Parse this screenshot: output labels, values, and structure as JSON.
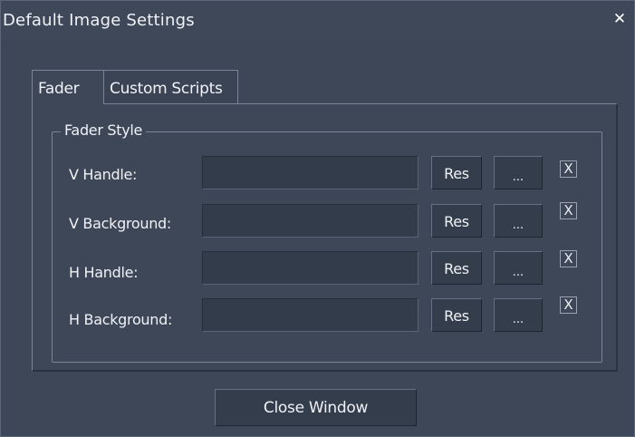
{
  "window": {
    "title": "Default Image Settings",
    "close_icon": "close-icon"
  },
  "tabs": [
    {
      "label": "Fader",
      "active": true
    },
    {
      "label": "Custom Scripts",
      "active": false
    }
  ],
  "fader_style": {
    "legend": "Fader Style",
    "rows": [
      {
        "label": "V Handle:",
        "value": "",
        "res_label": "Res",
        "browse_label": "...",
        "clear_label": "X"
      },
      {
        "label": "V Background:",
        "value": "",
        "res_label": "Res",
        "browse_label": "...",
        "clear_label": "X"
      },
      {
        "label": "H Handle:",
        "value": "",
        "res_label": "Res",
        "browse_label": "...",
        "clear_label": "X"
      },
      {
        "label": "H Background:",
        "value": "",
        "res_label": "Res",
        "browse_label": "...",
        "clear_label": "X"
      }
    ]
  },
  "footer": {
    "close_window_label": "Close Window"
  },
  "colors": {
    "background": "#3d4758",
    "text": "#f0f2f6"
  }
}
